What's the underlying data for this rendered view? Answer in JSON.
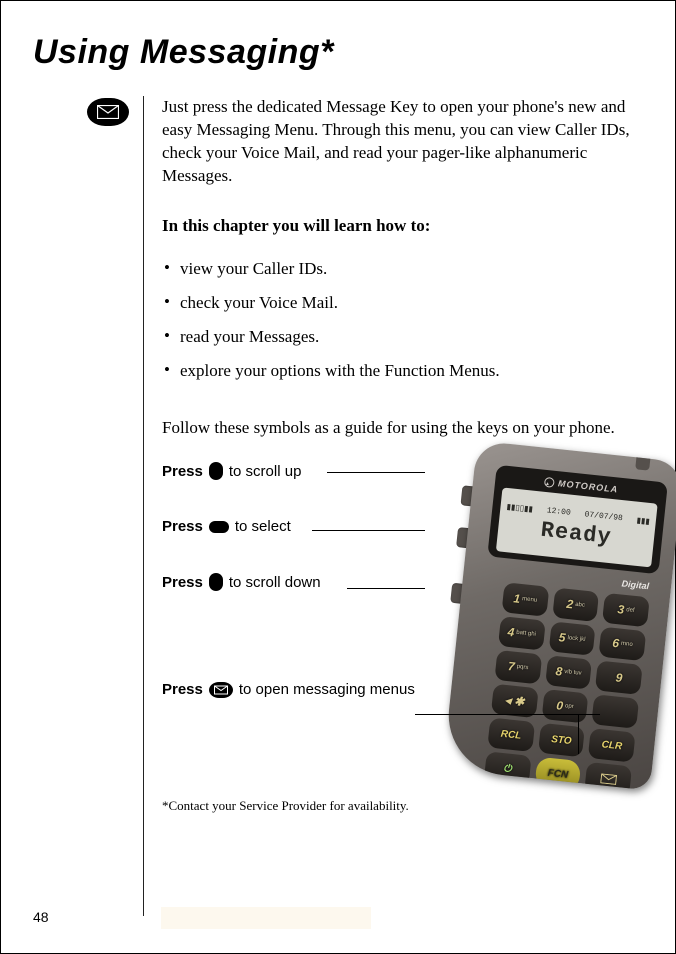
{
  "title": "Using Messaging*",
  "intro": "Just press the dedicated Message Key to open your phone's new and easy Messaging Menu. Through this menu, you can view Caller IDs, check your Voice Mail, and read your pager-like alphanumeric Messages.",
  "chapter_label": "In this chapter you will learn how to:",
  "bullets": [
    "view your Caller IDs.",
    "check your Voice Mail.",
    "read your Messages.",
    "explore your options with the Function Menus."
  ],
  "follow": "Follow these symbols as a guide for using the keys on your phone.",
  "keys": {
    "press": "Press",
    "scroll_up": " to scroll up",
    "select": " to select",
    "scroll_down": " to scroll down",
    "open_msg": " to open messaging menus"
  },
  "footnote": "*Contact your Service Provider for availability.",
  "page_number": "48",
  "phone": {
    "brand": "MOTOROLA",
    "time": "12:00",
    "date": "07/07/98",
    "screen_text": "Ready",
    "digital": "Digital",
    "keypad": {
      "k1": {
        "n": "1",
        "s": "menu"
      },
      "k2": {
        "n": "2",
        "s": "abc"
      },
      "k3": {
        "n": "3",
        "s": "def"
      },
      "k4": {
        "n": "4",
        "s": "batt ghi"
      },
      "k5": {
        "n": "5",
        "s": "lock jkl"
      },
      "k6": {
        "n": "6",
        "s": "mno"
      },
      "k7": {
        "n": "7",
        "s": "pqrs"
      },
      "k8": {
        "n": "8",
        "s": "vib tuv"
      },
      "k9": {
        "n": "9",
        "s": ""
      },
      "kstar": {
        "n": "◂ ✱",
        "s": ""
      },
      "k0": {
        "n": "0",
        "s": "opr"
      },
      "khash": {
        "n": "",
        "s": ""
      },
      "rcl": "RCL",
      "sto": "STO",
      "clr": "CLR",
      "fcn": "FCN"
    }
  }
}
